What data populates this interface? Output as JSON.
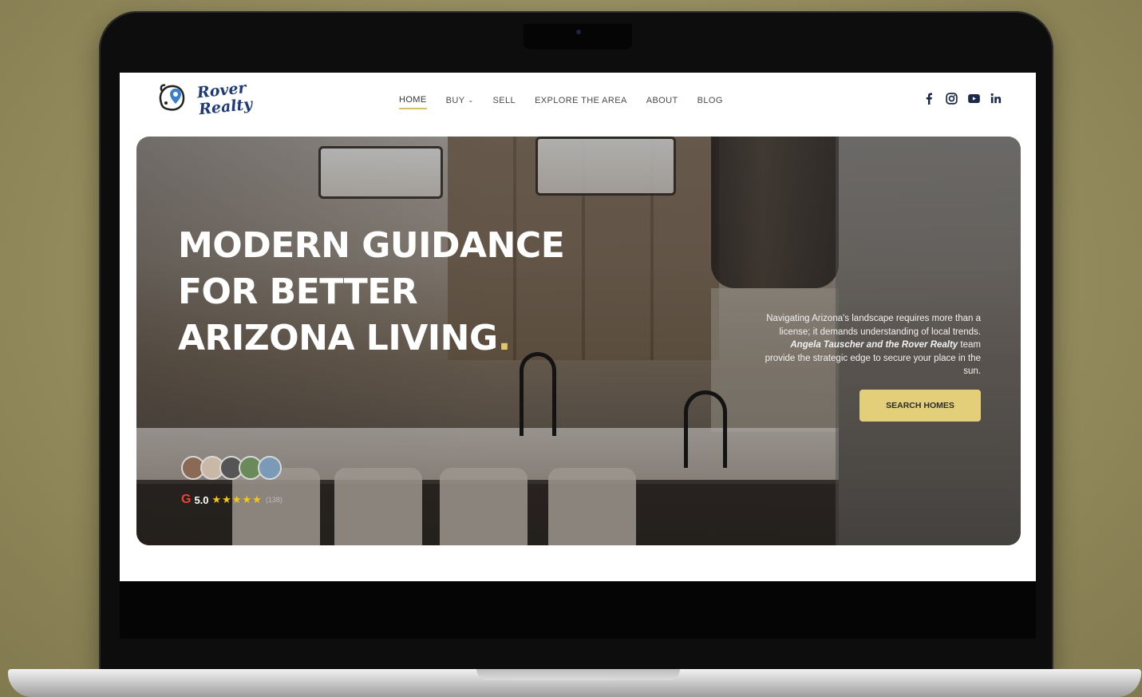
{
  "header": {
    "logo_text": "Rover Realty",
    "nav": [
      {
        "label": "HOME",
        "active": true
      },
      {
        "label": "BUY",
        "has_dropdown": true
      },
      {
        "label": "SELL"
      },
      {
        "label": "EXPLORE THE AREA"
      },
      {
        "label": "ABOUT"
      },
      {
        "label": "BLOG"
      }
    ],
    "socials": [
      "facebook-icon",
      "instagram-icon",
      "youtube-icon",
      "linkedin-icon"
    ]
  },
  "hero": {
    "headline_lines": [
      "MODERN GUIDANCE",
      "FOR BETTER",
      "ARIZONA LIVING"
    ],
    "headline_dot": ".",
    "subtext_before": "Navigating Arizona's landscape requires more than a license; it demands understanding of local trends.",
    "subtext_bold": "Angela Tauscher and the Rover Realty",
    "subtext_after": "team provide the strategic edge to secure your place in the sun.",
    "cta_label": "SEARCH HOMES",
    "rating_value": "5.0",
    "rating_stars": "★★★★★",
    "rating_count": "(138)"
  },
  "colors": {
    "accent": "#e3cf7a",
    "logo": "#1f3a78",
    "background": "#958d5f"
  }
}
